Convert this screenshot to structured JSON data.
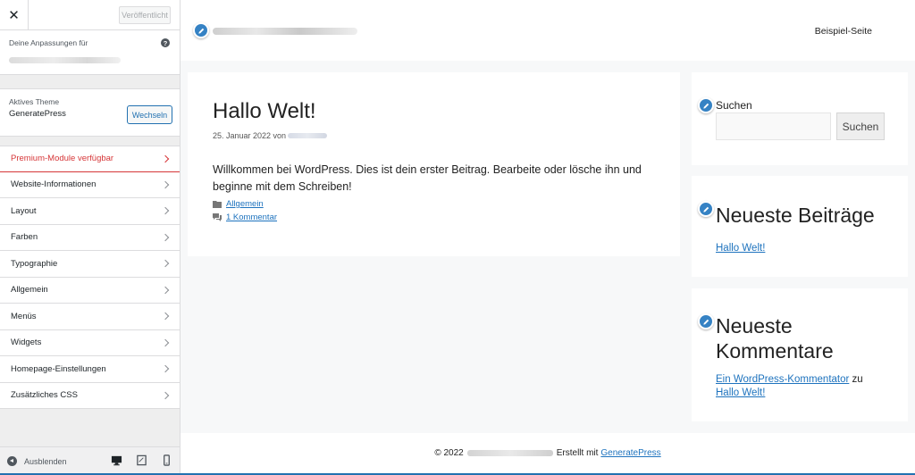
{
  "sidebar": {
    "close_label": "✕",
    "publish_label": "Veröffentlicht",
    "customizing_label": "Deine Anpassungen für",
    "help_label": "?",
    "active_theme_label": "Aktives Theme",
    "theme_name": "GeneratePress",
    "switch_label": "Wechseln",
    "items": [
      {
        "label": "Premium-Module verfügbar"
      },
      {
        "label": "Website-Informationen"
      },
      {
        "label": "Layout"
      },
      {
        "label": "Farben"
      },
      {
        "label": "Typographie"
      },
      {
        "label": "Allgemein"
      },
      {
        "label": "Menüs"
      },
      {
        "label": "Widgets"
      },
      {
        "label": "Homepage-Einstellungen"
      },
      {
        "label": "Zusätzliches CSS"
      }
    ],
    "collapse_label": "Ausblenden",
    "accent_color": "#2271b1",
    "premium_color": "#d63638"
  },
  "preview": {
    "nav_link": "Beispiel-Seite",
    "post": {
      "title": "Hallo Welt!",
      "date_prefix": "25. Januar 2022 von",
      "body": "Willkommen bei WordPress. Dies ist dein erster Beitrag. Bearbeite oder lösche ihn und beginne mit dem Schreiben!",
      "category": "Allgemein",
      "comments": "1 Kommentar"
    },
    "search_widget": {
      "label": "Suchen",
      "button": "Suchen"
    },
    "recent_posts": {
      "title": "Neueste Beiträge",
      "link": "Hallo Welt!"
    },
    "recent_comments": {
      "title": "Neueste Kommentare",
      "author": "Ein WordPress-Kommentator",
      "connector": "zu",
      "post": "Hallo Welt!"
    },
    "footer": {
      "prefix": "© 2022",
      "middle": "Erstellt mit",
      "link": "GeneratePress"
    },
    "link_color": "#1e73be",
    "edit_shortcut_color": "#3582c4"
  }
}
